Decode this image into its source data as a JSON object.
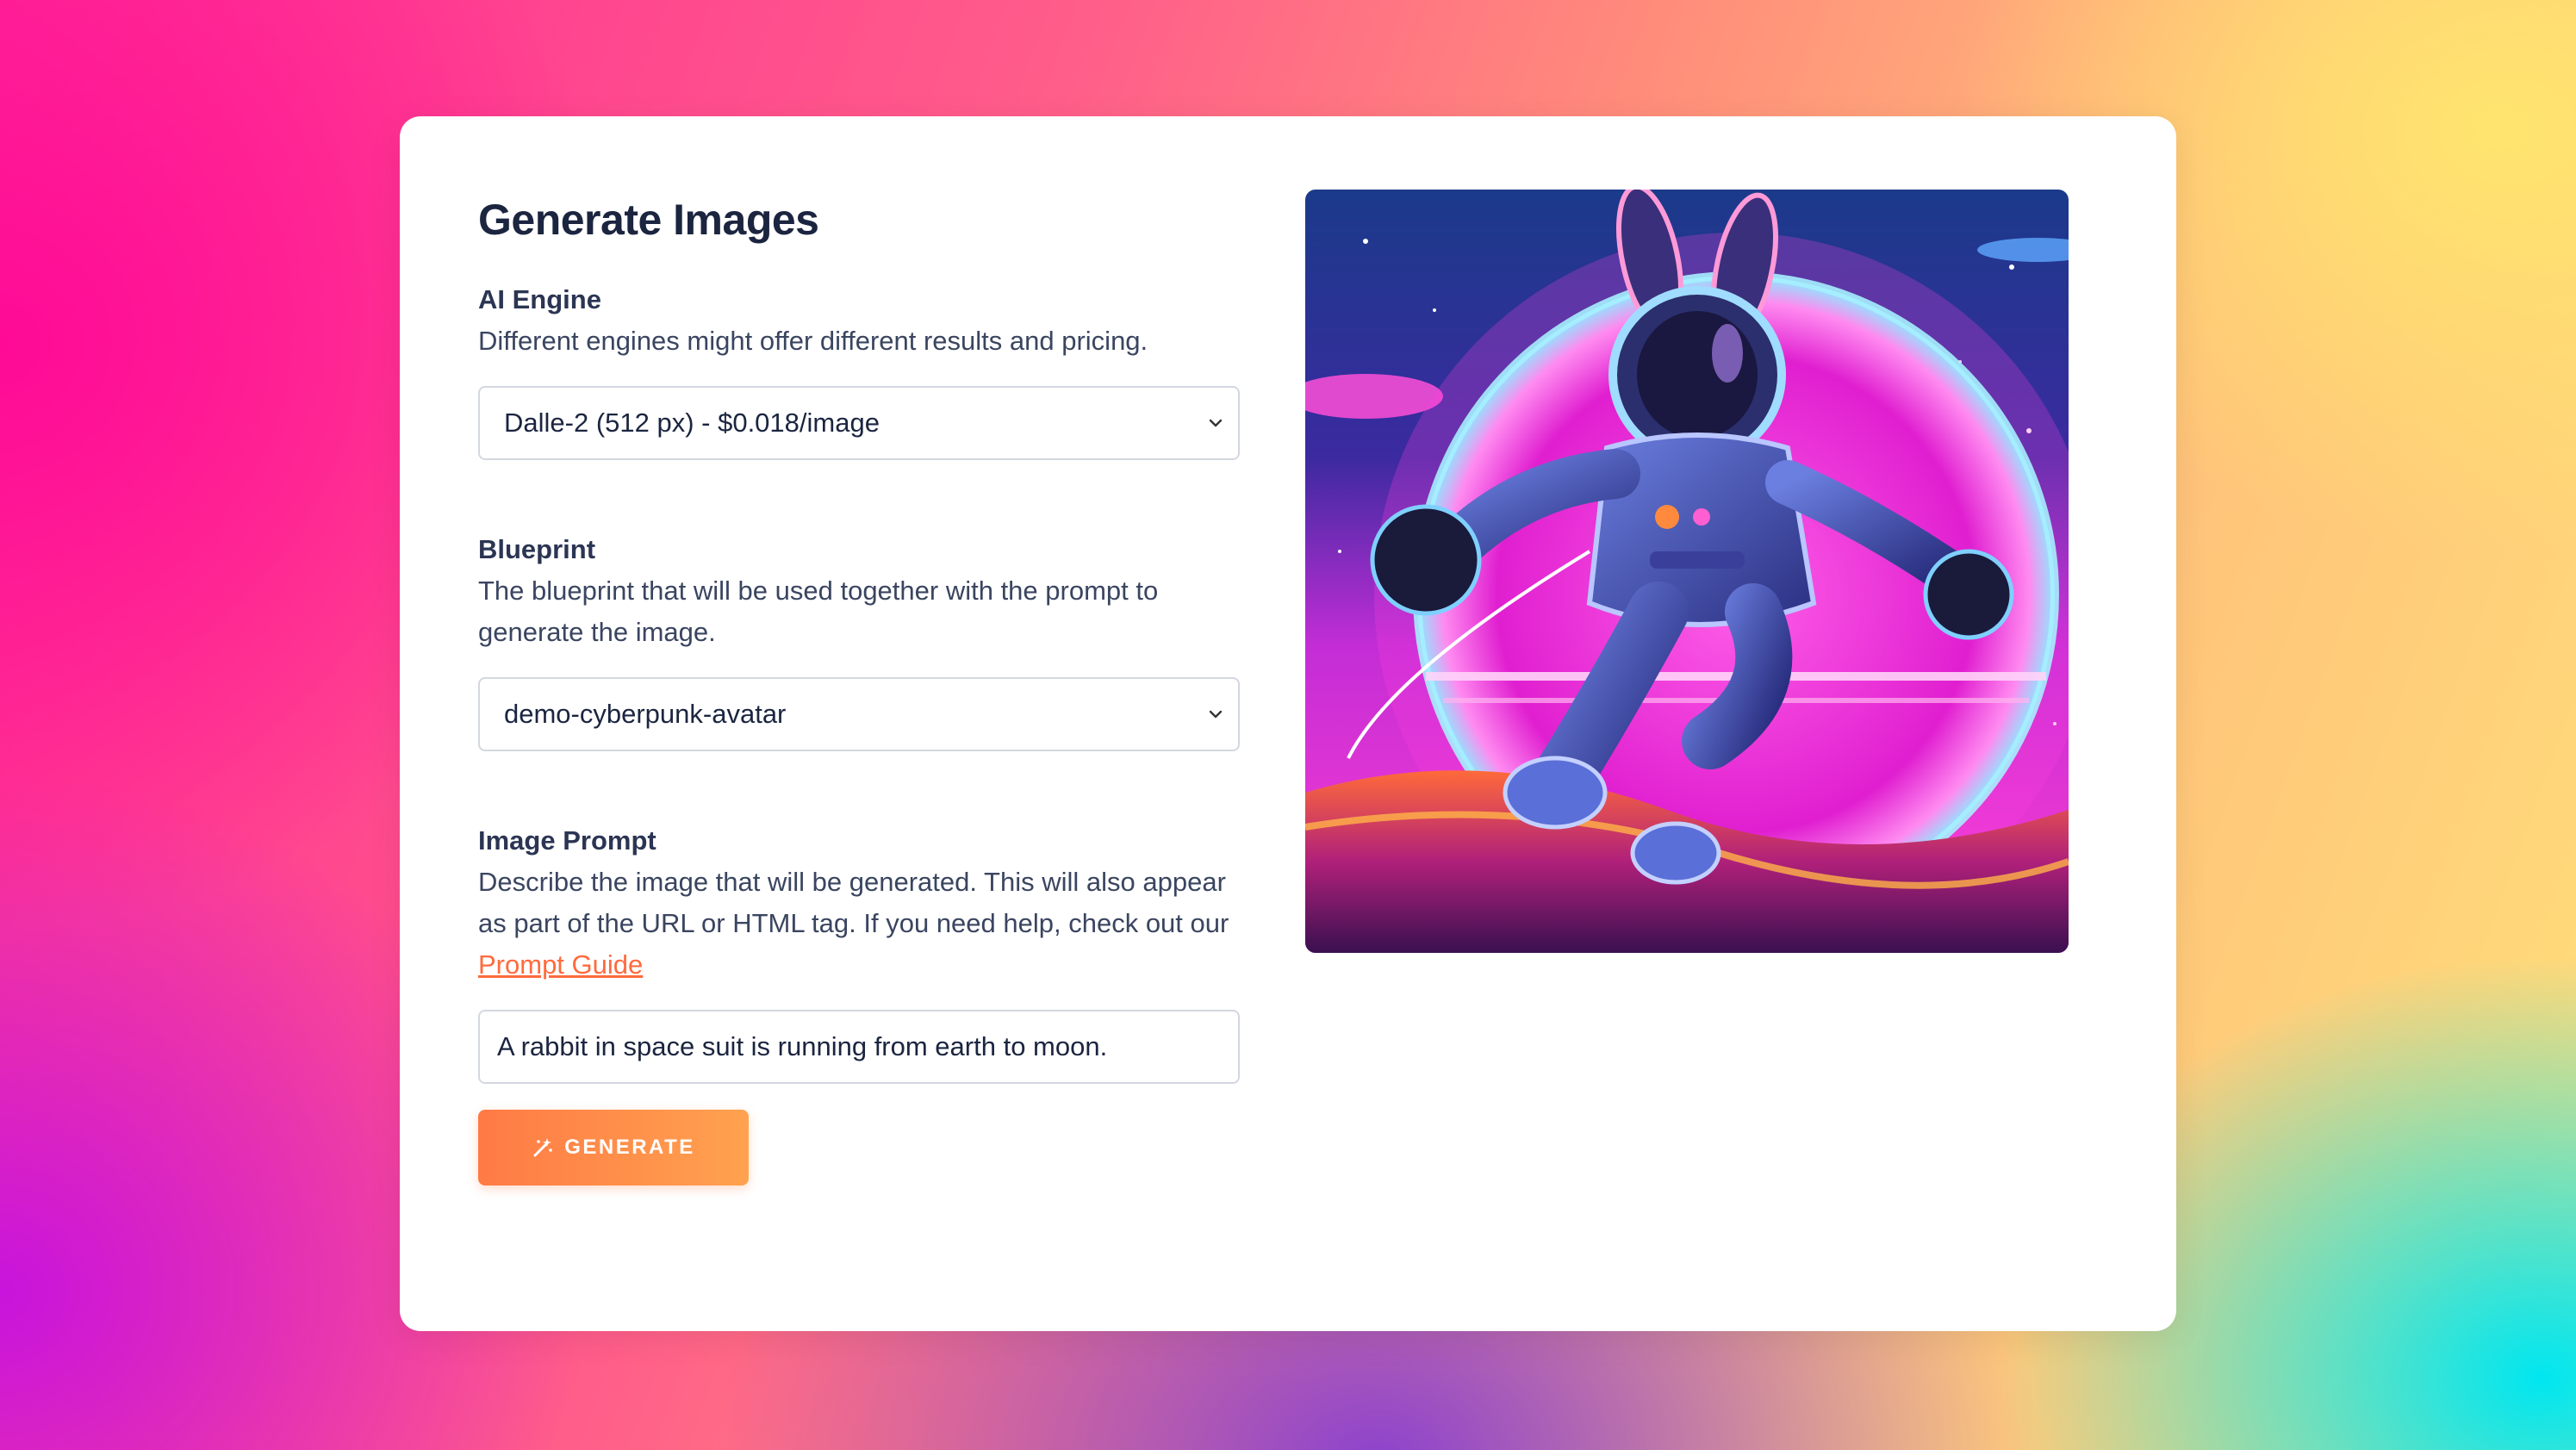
{
  "form": {
    "title": "Generate Images",
    "engine": {
      "label": "AI Engine",
      "description": "Different engines might offer different results and pricing.",
      "selected": "Dalle-2 (512 px) - $0.018/image"
    },
    "blueprint": {
      "label": "Blueprint",
      "description_line1": "The blueprint that will be used together with the prompt to",
      "description_line2": "generate the image.",
      "selected": "demo-cyberpunk-avatar"
    },
    "prompt": {
      "label": "Image Prompt",
      "description_line1": "Describe the image that will be generated. This will also appear",
      "description_line2": "as part of the URL or HTML tag. If you need help, check out our",
      "link_text": "Prompt Guide",
      "value": "A rabbit in space suit is running from earth to moon."
    },
    "generate_label": "GENERATE"
  },
  "preview": {
    "icon": "astronaut-rabbit-image"
  },
  "colors": {
    "accent": "#ff7a45",
    "link": "#ff6a3d",
    "title": "#1b2540"
  }
}
